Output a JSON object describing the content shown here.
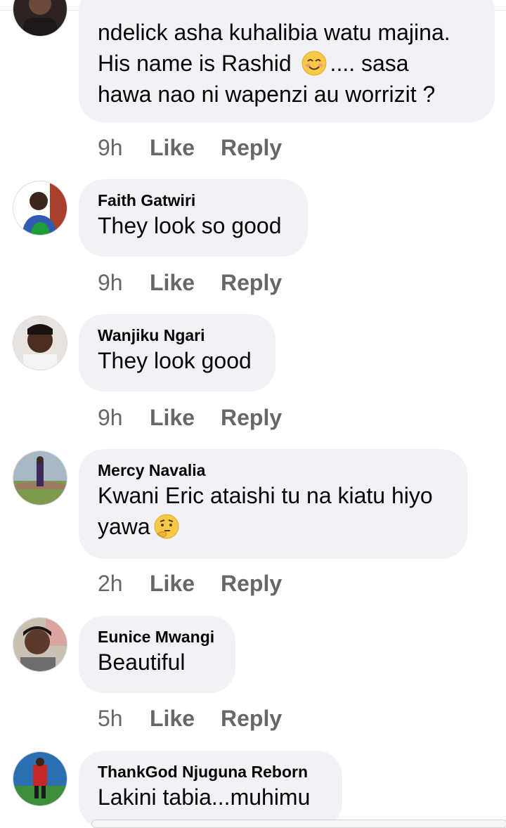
{
  "comments": [
    {
      "author": "",
      "line1": "ndelick asha kuhalibia watu majina.",
      "line2a": " His name is Rashid ",
      "emoji": "smiling-face-icon",
      "line2b": ".... sasa",
      "line3": "hawa nao ni wapenzi au worrizit ?",
      "time": "9h",
      "like": "Like",
      "reply": "Reply"
    },
    {
      "author": "Faith Gatwiri",
      "text": "They look so good",
      "time": "9h",
      "like": "Like",
      "reply": "Reply"
    },
    {
      "author": "Wanjiku Ngari",
      "text": "They look good",
      "time": "9h",
      "like": "Like",
      "reply": "Reply"
    },
    {
      "author": "Mercy Navalia",
      "line1": "Kwani Eric ataishi tu na kiatu hiyo",
      "line2": "yawa",
      "emoji": "thinking-face-icon",
      "time": "2h",
      "like": "Like",
      "reply": "Reply"
    },
    {
      "author": "Eunice Mwangi",
      "text": "Beautiful",
      "time": "5h",
      "like": "Like",
      "reply": "Reply"
    },
    {
      "author": "ThankGod Njuguna Reborn",
      "text": "Lakini tabia...muhimu"
    }
  ]
}
